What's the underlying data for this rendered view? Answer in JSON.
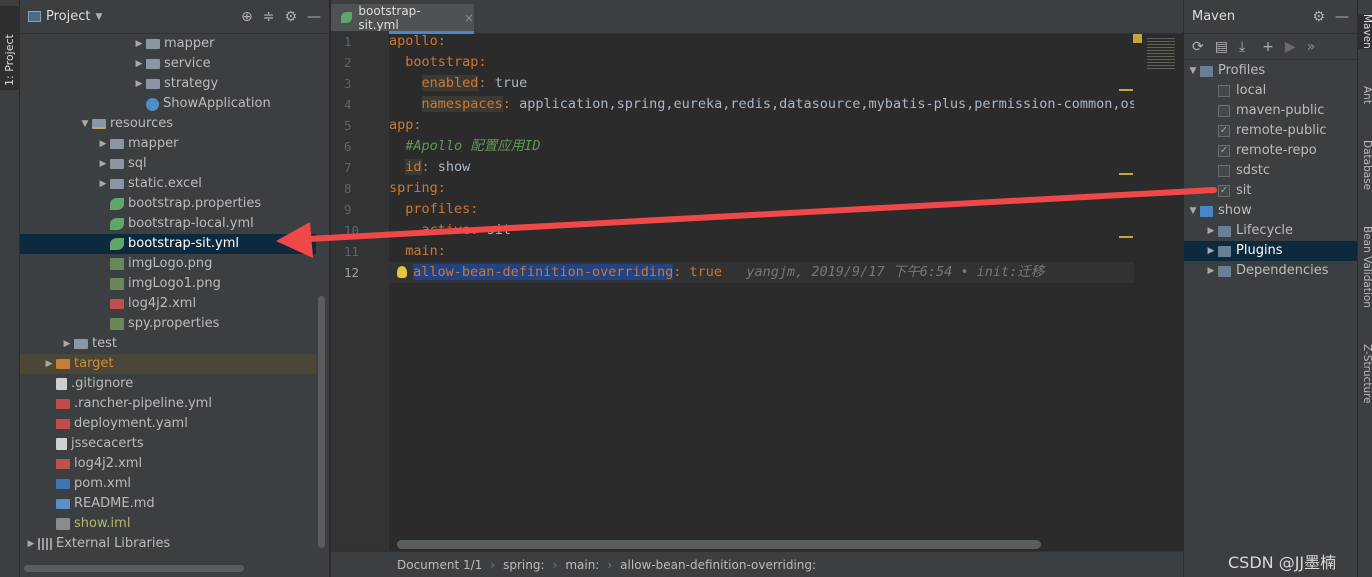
{
  "left_strip": {
    "tab": "1: Project"
  },
  "project": {
    "title": "Project",
    "tree": [
      {
        "label": "mapper",
        "indent": 6,
        "arrow": "▶",
        "icon": "folder"
      },
      {
        "label": "service",
        "indent": 6,
        "arrow": "▶",
        "icon": "folder"
      },
      {
        "label": "strategy",
        "indent": 6,
        "arrow": "▶",
        "icon": "folder"
      },
      {
        "label": "ShowApplication",
        "indent": 6,
        "arrow": "",
        "icon": "app"
      },
      {
        "label": "resources",
        "indent": 3,
        "arrow": "▼",
        "icon": "res"
      },
      {
        "label": "mapper",
        "indent": 4,
        "arrow": "▶",
        "icon": "folder"
      },
      {
        "label": "sql",
        "indent": 4,
        "arrow": "▶",
        "icon": "folder"
      },
      {
        "label": "static.excel",
        "indent": 4,
        "arrow": "▶",
        "icon": "folder"
      },
      {
        "label": "bootstrap.properties",
        "indent": 4,
        "arrow": "",
        "icon": "spring"
      },
      {
        "label": "bootstrap-local.yml",
        "indent": 4,
        "arrow": "",
        "icon": "spring"
      },
      {
        "label": "bootstrap-sit.yml",
        "indent": 4,
        "arrow": "",
        "icon": "spring",
        "state": "selected"
      },
      {
        "label": "imgLogo.png",
        "indent": 4,
        "arrow": "",
        "icon": "img"
      },
      {
        "label": "imgLogo1.png",
        "indent": 4,
        "arrow": "",
        "icon": "img"
      },
      {
        "label": "log4j2.xml",
        "indent": 4,
        "arrow": "",
        "icon": "xml"
      },
      {
        "label": "spy.properties",
        "indent": 4,
        "arrow": "",
        "icon": "img"
      },
      {
        "label": "test",
        "indent": 2,
        "arrow": "▶",
        "icon": "folder"
      },
      {
        "label": "target",
        "indent": 1,
        "arrow": "▶",
        "icon": "folder-orange",
        "state": "excluded"
      },
      {
        "label": ".gitignore",
        "indent": 1,
        "arrow": "",
        "icon": "file"
      },
      {
        "label": ".rancher-pipeline.yml",
        "indent": 1,
        "arrow": "",
        "icon": "yml"
      },
      {
        "label": "deployment.yaml",
        "indent": 1,
        "arrow": "",
        "icon": "yml"
      },
      {
        "label": "jssecacerts",
        "indent": 1,
        "arrow": "",
        "icon": "file"
      },
      {
        "label": "log4j2.xml",
        "indent": 1,
        "arrow": "",
        "icon": "xml"
      },
      {
        "label": "pom.xml",
        "indent": 1,
        "arrow": "",
        "icon": "mvn"
      },
      {
        "label": "README.md",
        "indent": 1,
        "arrow": "",
        "icon": "md"
      },
      {
        "label": "show.iml",
        "indent": 1,
        "arrow": "",
        "icon": "iml",
        "state": "olive"
      },
      {
        "label": "External Libraries",
        "indent": 0,
        "arrow": "▶",
        "icon": "lib"
      }
    ]
  },
  "editor": {
    "tab_label": "bootstrap-sit.yml",
    "line_numbers": [
      "1",
      "2",
      "3",
      "4",
      "5",
      "6",
      "7",
      "8",
      "9",
      "10",
      "11",
      "12"
    ],
    "lines": [
      {
        "key": "apollo",
        "indent": "",
        "value": "",
        "keyStyle": ""
      },
      {
        "key": "bootstrap",
        "indent": "  ",
        "value": "",
        "keyStyle": ""
      },
      {
        "key": "enabled",
        "indent": "    ",
        "value": " true",
        "keyStyle": "hl"
      },
      {
        "key": "namespaces",
        "indent": "    ",
        "value": " application,spring,eureka,redis,datasource,mybatis-plus,permission-common,oss",
        "keyStyle": "hl"
      },
      {
        "key": "app",
        "indent": "",
        "value": "",
        "keyStyle": ""
      },
      {
        "comment": "#Apollo 配置应用ID",
        "indent": "  "
      },
      {
        "key": "id",
        "indent": "  ",
        "value": " show",
        "keyStyle": "hl"
      },
      {
        "key": "spring",
        "indent": "",
        "value": "",
        "keyStyle": ""
      },
      {
        "key": "profiles",
        "indent": "  ",
        "value": "",
        "keyStyle": ""
      },
      {
        "key": "active",
        "indent": "    ",
        "value": " sit",
        "keyStyle": ""
      },
      {
        "key": "main",
        "indent": "  ",
        "value": "",
        "keyStyle": ""
      },
      {
        "key": "allow-bean-definition-overriding",
        "indent": "  ",
        "value": " true",
        "keyStyle": "sel",
        "annotation": "   yangjm, 2019/9/17 下午6:54 • init:迁移",
        "bulb": true
      }
    ],
    "breadcrumb": [
      "Document 1/1",
      "spring:",
      "main:",
      "allow-bean-definition-overriding:"
    ]
  },
  "maven": {
    "title": "Maven",
    "tree": [
      {
        "label": "Profiles",
        "indent": 0,
        "arrow": "▼",
        "kind": "folder"
      },
      {
        "label": "local",
        "indent": 1,
        "kind": "checkbox",
        "checked": false
      },
      {
        "label": "maven-public",
        "indent": 1,
        "kind": "checkbox",
        "checked": false
      },
      {
        "label": "remote-public",
        "indent": 1,
        "kind": "checkbox",
        "checked": true
      },
      {
        "label": "remote-repo",
        "indent": 1,
        "kind": "checkbox",
        "checked": true
      },
      {
        "label": "sdstc",
        "indent": 1,
        "kind": "checkbox",
        "checked": false
      },
      {
        "label": "sit",
        "indent": 1,
        "kind": "checkbox",
        "checked": true
      },
      {
        "label": "show",
        "indent": 0,
        "arrow": "▼",
        "kind": "module"
      },
      {
        "label": "Lifecycle",
        "indent": 1,
        "arrow": "▶",
        "kind": "folder"
      },
      {
        "label": "Plugins",
        "indent": 1,
        "arrow": "▶",
        "kind": "folder",
        "state": "selected"
      },
      {
        "label": "Dependencies",
        "indent": 1,
        "arrow": "▶",
        "kind": "folder"
      }
    ]
  },
  "right_strip": [
    "Maven",
    "Ant",
    "Database",
    "Bean Validation",
    "Z-Structure"
  ],
  "watermark": "CSDN @JJ墨楠"
}
